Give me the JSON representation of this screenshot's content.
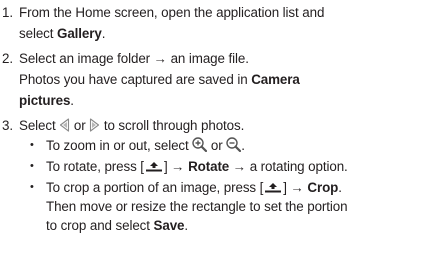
{
  "steps": [
    {
      "number": "1.",
      "line1_pre": "From the Home screen, open the application list and",
      "line2_pre": "select ",
      "line2_bold": "Gallery",
      "line2_post": "."
    },
    {
      "number": "2.",
      "line1": "Select an image folder → an image file.",
      "line2_pre": "Photos you have captured are saved in ",
      "line2_bold": "Camera",
      "line3_bold": "pictures",
      "line3_post": "."
    },
    {
      "number": "3.",
      "line1_pre": "Select ",
      "line1_mid": " or ",
      "line1_post": " to scroll through photos.",
      "bullets": [
        {
          "pre": "To zoom in or out, select ",
          "mid": " or ",
          "post": "."
        },
        {
          "pre": "To rotate, press [",
          "mid": "] → ",
          "bold": "Rotate",
          "post": " → a rotating option."
        },
        {
          "pre": "To crop a portion of an image, press [",
          "mid": "] → ",
          "bold": "Crop",
          "post": ".",
          "line2": "Then move or resize the rectangle to set the portion",
          "line3_pre": "to crop and select ",
          "line3_bold": "Save",
          "line3_post": "."
        }
      ]
    }
  ],
  "bullet_glyph": "•",
  "icons": {
    "prev": "left-arrow-icon",
    "next": "right-arrow-icon",
    "zoom_in": "zoom-in-icon",
    "zoom_out": "zoom-out-icon",
    "menu": "menu-key-icon"
  }
}
